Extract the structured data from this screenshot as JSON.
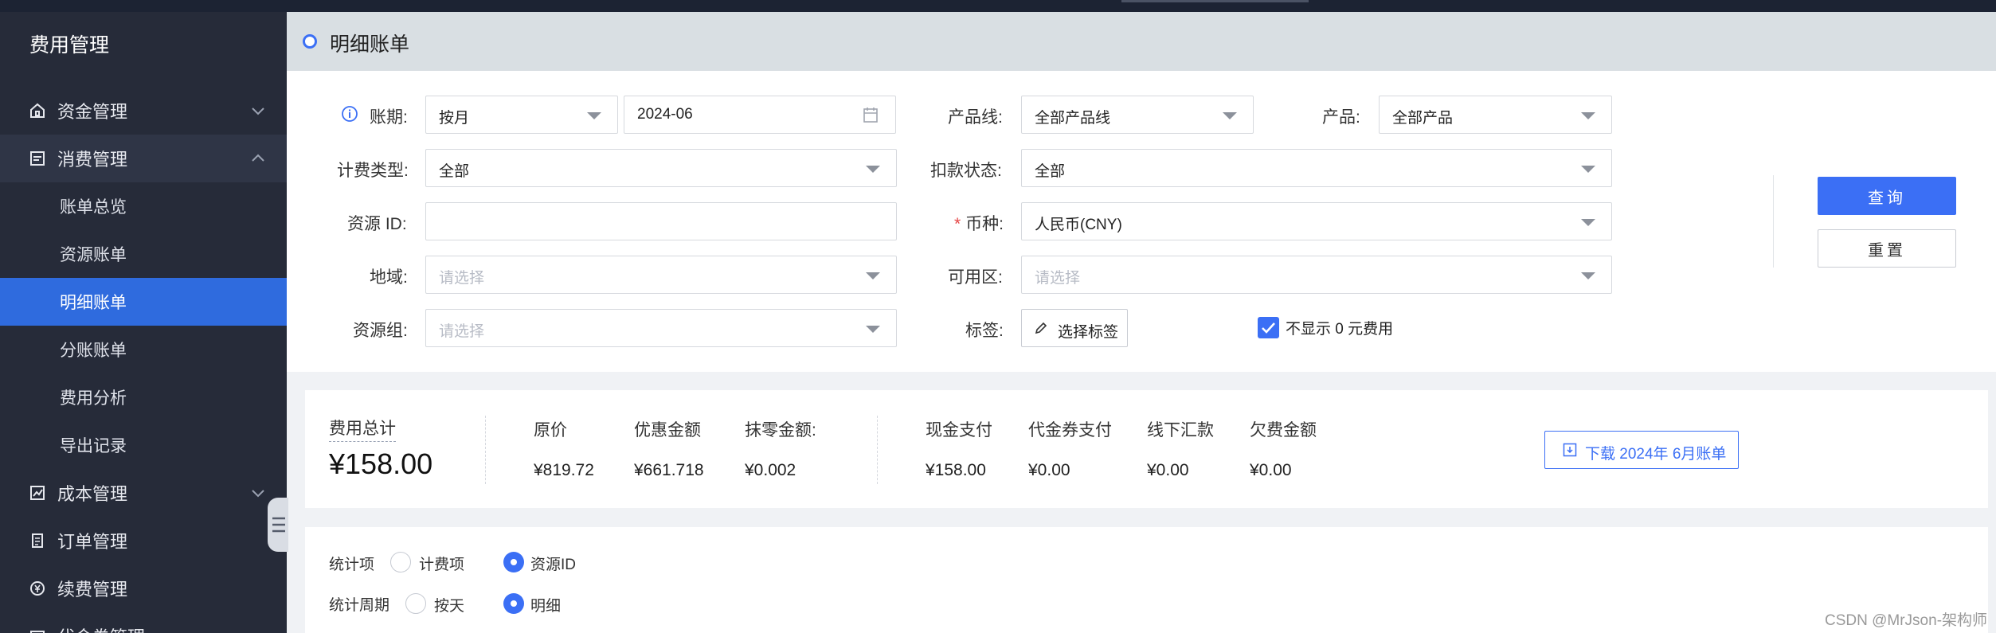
{
  "sidebar": {
    "title": "费用管理",
    "menu": [
      {
        "label": "资金管理",
        "icon": "home-icon",
        "expanded": false
      },
      {
        "label": "消费管理",
        "icon": "bill-icon",
        "expanded": true
      },
      {
        "label": "成本管理",
        "icon": "chart-icon",
        "expanded": false
      },
      {
        "label": "订单管理",
        "icon": "order-icon"
      },
      {
        "label": "续费管理",
        "icon": "renew-icon"
      },
      {
        "label": "代金券管理",
        "icon": "coupon-icon"
      }
    ],
    "sub_items": [
      "账单总览",
      "资源账单",
      "明细账单",
      "分账账单",
      "费用分析",
      "导出记录"
    ],
    "active_sub": "明细账单"
  },
  "header": {
    "title": "明细账单"
  },
  "filters": {
    "period_label": "账期:",
    "period_mode": "按月",
    "period_month": "2024-06",
    "product_line_label": "产品线:",
    "product_line_value": "全部产品线",
    "product_label": "产品:",
    "product_value": "全部产品",
    "billing_type_label": "计费类型:",
    "billing_type_value": "全部",
    "deduct_status_label": "扣款状态:",
    "deduct_status_value": "全部",
    "resource_id_label": "资源 ID:",
    "resource_id_value": "",
    "currency_label": "币种:",
    "currency_value": "人民币(CNY)",
    "region_label": "地域:",
    "region_placeholder": "请选择",
    "zone_label": "可用区:",
    "zone_placeholder": "请选择",
    "resource_group_label": "资源组:",
    "resource_group_placeholder": "请选择",
    "tag_label": "标签:",
    "tag_button": "选择标签",
    "hide_zero_label": "不显示 0 元费用",
    "hide_zero_checked": true,
    "query_button": "查询",
    "reset_button": "重置"
  },
  "summary": {
    "total_label": "费用总计",
    "total_value": "¥158.00",
    "original_label": "原价",
    "original_value": "¥819.72",
    "discount_label": "优惠金额",
    "discount_value": "¥661.718",
    "rounding_label": "抹零金额:",
    "rounding_value": "¥0.002",
    "cash_label": "现金支付",
    "cash_value": "¥158.00",
    "voucher_label": "代金券支付",
    "voucher_value": "¥0.00",
    "offline_label": "线下汇款",
    "offline_value": "¥0.00",
    "arrears_label": "欠费金额",
    "arrears_value": "¥0.00",
    "download_button": "下载 2024年 6月账单"
  },
  "stats": {
    "item_label": "统计项",
    "item_options": [
      "计费项",
      "资源ID"
    ],
    "item_selected": "资源ID",
    "period_label": "统计周期",
    "period_options": [
      "按天",
      "明细"
    ],
    "period_selected": "明细"
  },
  "watermark": "CSDN @MrJson-架构师",
  "colors": {
    "accent": "#3b6ff5",
    "sidebar_bg": "#262b39",
    "active_bg": "#2f6bde"
  }
}
